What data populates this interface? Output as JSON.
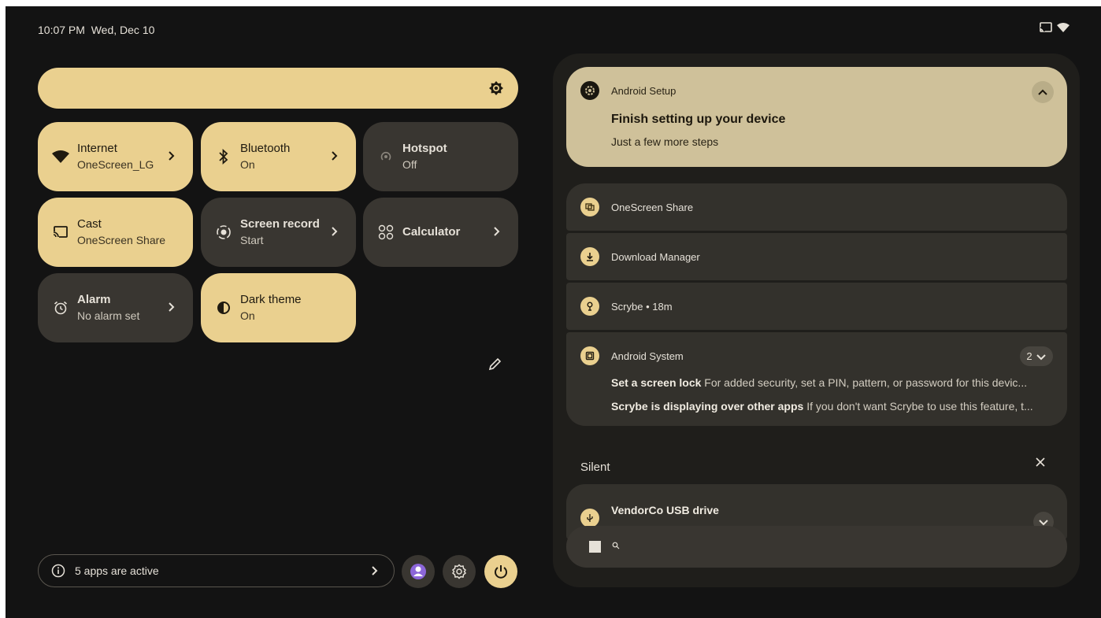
{
  "status_bar": {
    "time": "10:07 PM",
    "date": "Wed, Dec 10",
    "icons": [
      "cast-icon",
      "wifi-icon"
    ]
  },
  "brightness": {
    "icon": "brightness-icon"
  },
  "tiles": [
    {
      "label": "Internet",
      "sub": "OneScreen_LG",
      "state": "on",
      "icon": "wifi-icon",
      "chevron": true
    },
    {
      "label": "Bluetooth",
      "sub": "On",
      "state": "on",
      "icon": "bluetooth-icon",
      "chevron": true
    },
    {
      "label": "Hotspot",
      "sub": "Off",
      "state": "off",
      "icon": "hotspot-icon",
      "chevron": false
    },
    {
      "label": "Cast",
      "sub": "OneScreen Share",
      "state": "on",
      "icon": "cast-icon",
      "chevron": false
    },
    {
      "label": "Screen record",
      "sub": "Start",
      "state": "off",
      "icon": "screen-record-icon",
      "chevron": true
    },
    {
      "label": "Calculator",
      "sub": "",
      "state": "off",
      "icon": "calculator-icon",
      "chevron": true
    },
    {
      "label": "Alarm",
      "sub": "No alarm set",
      "state": "off",
      "icon": "alarm-icon",
      "chevron": true
    },
    {
      "label": "Dark theme",
      "sub": "On",
      "state": "on",
      "icon": "dark-theme-icon",
      "chevron": false
    }
  ],
  "footer": {
    "apps_active": "5 apps are active",
    "buttons": [
      "user-avatar-icon",
      "settings-icon",
      "power-icon"
    ]
  },
  "notifications": {
    "highlight": {
      "app": "Android Setup",
      "title": "Finish setting up your device",
      "body": "Just a few more steps"
    },
    "collapsed": [
      {
        "app": "OneScreen Share"
      },
      {
        "app": "Download Manager"
      },
      {
        "app": "Scrybe • 18m"
      }
    ],
    "system": {
      "app": "Android System",
      "count": "2",
      "items": [
        {
          "title": "Set a screen lock",
          "body": "For added security, set a PIN, pattern, or password for this devic..."
        },
        {
          "title": "Scrybe is displaying over other apps",
          "body": "If you don't want Scrybe to use this feature, t..."
        }
      ]
    },
    "silent_label": "Silent",
    "silent_item": {
      "title": "VendorCo USB drive"
    }
  },
  "colors": {
    "accent": "#ead08f",
    "highlight": "#cfc19a",
    "tile_off": "#393631",
    "background": "#131313"
  }
}
